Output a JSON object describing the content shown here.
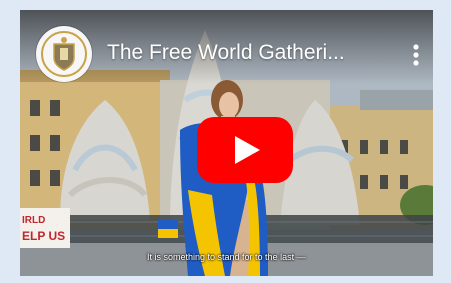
{
  "video": {
    "title": "The Free World Gatheri...",
    "caption": "It is something to stand for to the last —"
  },
  "banner": {
    "text_line1": "IRLD",
    "text_line2": "ELP US"
  },
  "icons": {
    "avatar": "channel-crest-icon",
    "more": "more-vertical-icon",
    "play": "youtube-play-icon"
  },
  "colors": {
    "play_red": "#ff0000",
    "flag_blue": "#1f5cc4",
    "flag_yellow": "#f5c400",
    "page_bg": "#dfe9f5"
  }
}
